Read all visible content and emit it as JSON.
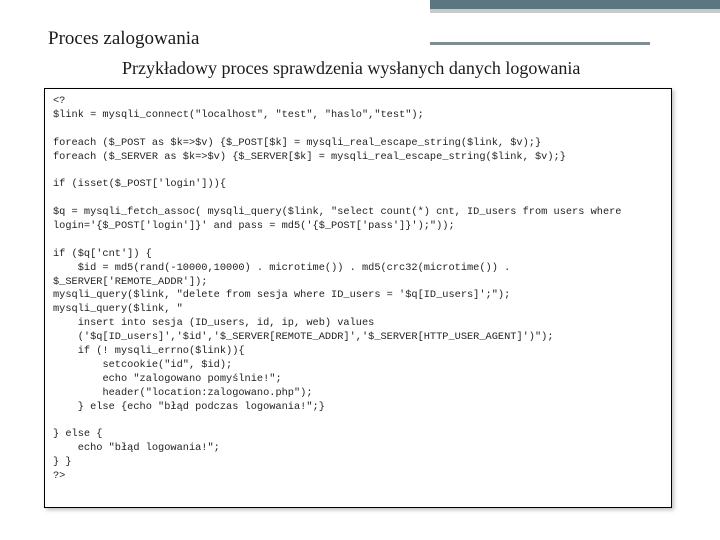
{
  "slide": {
    "title": "Proces zalogowania",
    "subtitle": "Przykładowy proces sprawdzenia wysłanych danych logowania"
  },
  "code": "<?\n$link = mysqli_connect(\"localhost\", \"test\", \"haslo\",\"test\");\n\nforeach ($_POST as $k=>$v) {$_POST[$k] = mysqli_real_escape_string($link, $v);}\nforeach ($_SERVER as $k=>$v) {$_SERVER[$k] = mysqli_real_escape_string($link, $v);}\n\nif (isset($_POST['login'])){\n\n$q = mysqli_fetch_assoc( mysqli_query($link, \"select count(*) cnt, ID_users from users where login='{$_POST['login']}' and pass = md5('{$_POST['pass']}');\"));\n\nif ($q['cnt']) {\n    $id = md5(rand(-10000,10000) . microtime()) . md5(crc32(microtime()) . $_SERVER['REMOTE_ADDR']);\nmysqli_query($link, \"delete from sesja where ID_users = '$q[ID_users]';\");\nmysqli_query($link, \"\n    insert into sesja (ID_users, id, ip, web) values\n    ('$q[ID_users]','$id','$_SERVER[REMOTE_ADDR]','$_SERVER[HTTP_USER_AGENT]')\");\n    if (! mysqli_errno($link)){\n        setcookie(\"id\", $id);\n        echo \"zalogowano pomyślnie!\";\n        header(\"location:zalogowano.php\");\n    } else {echo \"błąd podczas logowania!\";}\n\n} else {\n    echo \"błąd logowania!\";\n} }\n?>"
}
